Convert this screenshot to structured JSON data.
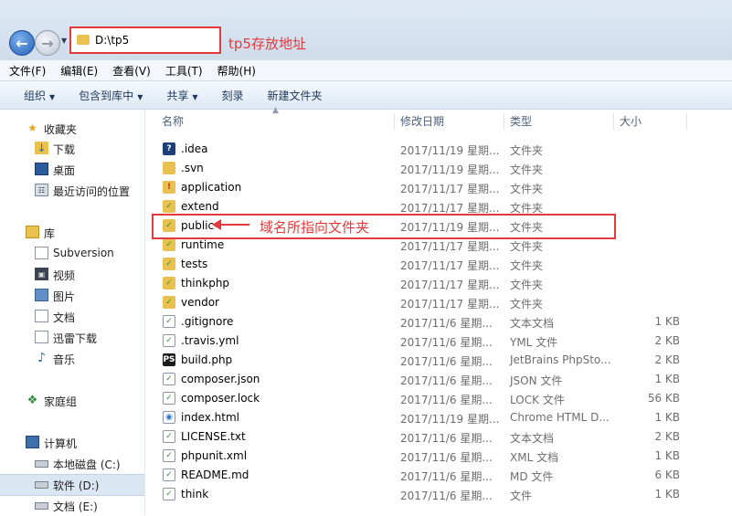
{
  "address": {
    "path": "D:\\tp5",
    "annotation": "tp5存放地址"
  },
  "menu": [
    "文件(F)",
    "编辑(E)",
    "查看(V)",
    "工具(T)",
    "帮助(H)"
  ],
  "toolbar": [
    {
      "label": "组织",
      "dropdown": true
    },
    {
      "label": "包含到库中",
      "dropdown": true
    },
    {
      "label": "共享",
      "dropdown": true
    },
    {
      "label": "刻录",
      "dropdown": false
    },
    {
      "label": "新建文件夹",
      "dropdown": false
    }
  ],
  "sidebar": {
    "favorites": {
      "label": "收藏夹",
      "items": [
        "下载",
        "桌面",
        "最近访问的位置"
      ]
    },
    "libraries": {
      "label": "库",
      "items": [
        "Subversion",
        "视频",
        "图片",
        "文档",
        "迅雷下载",
        "音乐"
      ]
    },
    "homegroup": "家庭组",
    "computer": {
      "label": "计算机",
      "items": [
        "本地磁盘 (C:)",
        "软件 (D:)",
        "文档 (E:)"
      ]
    },
    "selected": "软件 (D:)"
  },
  "columns": {
    "name": "名称",
    "date": "修改日期",
    "type": "类型",
    "size": "大小"
  },
  "files": [
    {
      "name": ".idea",
      "date": "2017/11/19 星期...",
      "type": "文件夹",
      "size": "",
      "icon": "idea-folder-icon"
    },
    {
      "name": ".svn",
      "date": "2017/11/19 星期...",
      "type": "文件夹",
      "size": "",
      "icon": "folder-icon"
    },
    {
      "name": "application",
      "date": "2017/11/17 星期...",
      "type": "文件夹",
      "size": "",
      "icon": "svn-modified-folder-icon"
    },
    {
      "name": "extend",
      "date": "2017/11/17 星期...",
      "type": "文件夹",
      "size": "",
      "icon": "svn-folder-icon"
    },
    {
      "name": "public",
      "date": "2017/11/19 星期...",
      "type": "文件夹",
      "size": "",
      "icon": "svn-folder-icon"
    },
    {
      "name": "runtime",
      "date": "2017/11/17 星期...",
      "type": "文件夹",
      "size": "",
      "icon": "svn-folder-icon"
    },
    {
      "name": "tests",
      "date": "2017/11/17 星期...",
      "type": "文件夹",
      "size": "",
      "icon": "svn-folder-icon"
    },
    {
      "name": "thinkphp",
      "date": "2017/11/17 星期...",
      "type": "文件夹",
      "size": "",
      "icon": "svn-folder-icon"
    },
    {
      "name": "vendor",
      "date": "2017/11/17 星期...",
      "type": "文件夹",
      "size": "",
      "icon": "svn-folder-icon"
    },
    {
      "name": ".gitignore",
      "date": "2017/11/6 星期...",
      "type": "文本文档",
      "size": "1 KB",
      "icon": "svn-file-icon"
    },
    {
      "name": ".travis.yml",
      "date": "2017/11/6 星期...",
      "type": "YML 文件",
      "size": "2 KB",
      "icon": "svn-file-icon"
    },
    {
      "name": "build.php",
      "date": "2017/11/6 星期...",
      "type": "JetBrains PhpSto...",
      "size": "2 KB",
      "icon": "phpstorm-file-icon"
    },
    {
      "name": "composer.json",
      "date": "2017/11/6 星期...",
      "type": "JSON 文件",
      "size": "1 KB",
      "icon": "svn-file-icon"
    },
    {
      "name": "composer.lock",
      "date": "2017/11/6 星期...",
      "type": "LOCK 文件",
      "size": "56 KB",
      "icon": "svn-file-icon"
    },
    {
      "name": "index.html",
      "date": "2017/11/19 星期...",
      "type": "Chrome HTML D...",
      "size": "1 KB",
      "icon": "chrome-file-icon"
    },
    {
      "name": "LICENSE.txt",
      "date": "2017/11/6 星期...",
      "type": "文本文档",
      "size": "2 KB",
      "icon": "svn-file-icon"
    },
    {
      "name": "phpunit.xml",
      "date": "2017/11/6 星期...",
      "type": "XML 文档",
      "size": "1 KB",
      "icon": "svn-file-icon"
    },
    {
      "name": "README.md",
      "date": "2017/11/6 星期...",
      "type": "MD 文件",
      "size": "6 KB",
      "icon": "svn-file-icon"
    },
    {
      "name": "think",
      "date": "2017/11/6 星期...",
      "type": "文件",
      "size": "1 KB",
      "icon": "svn-file-icon"
    }
  ],
  "public_annotation": "域名所指向文件夹",
  "colors": {
    "annotation_red": "#e23b3b",
    "folder_yellow": "#e8c150",
    "svn_green": "#3aa63a"
  }
}
